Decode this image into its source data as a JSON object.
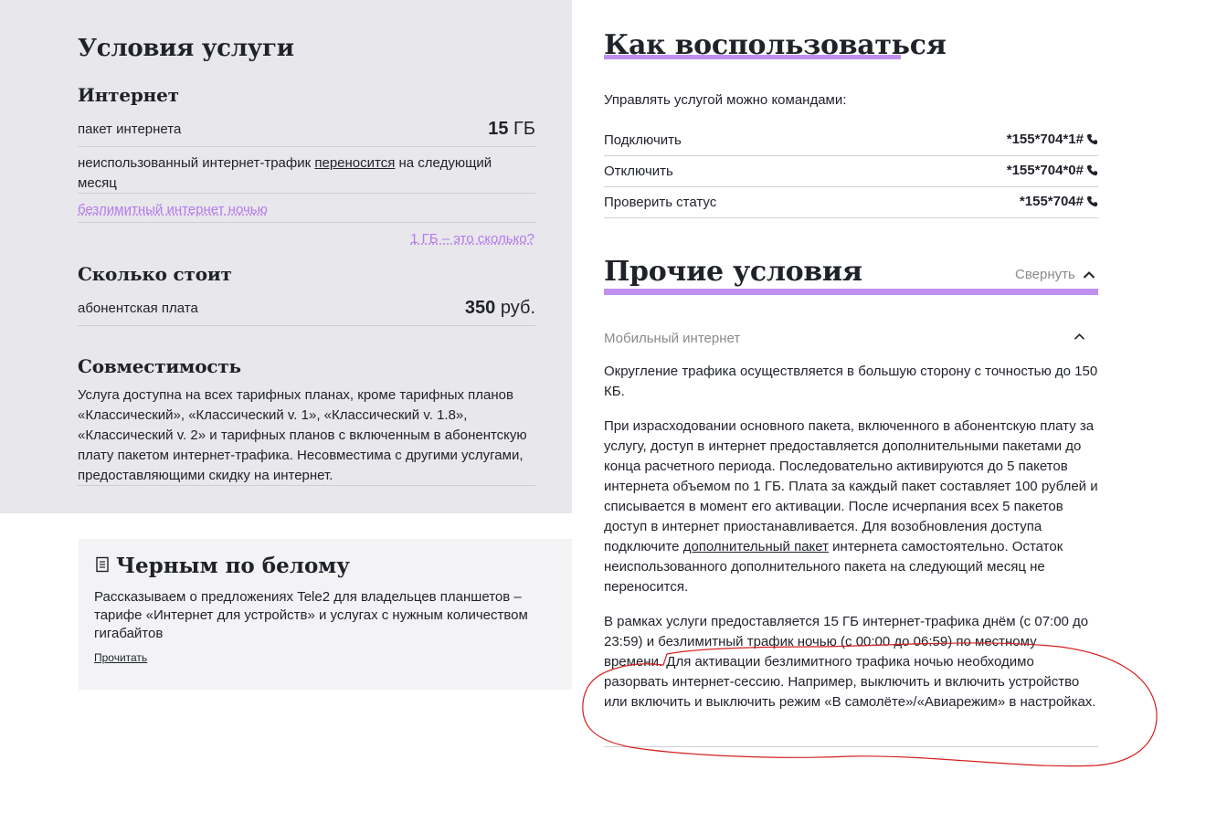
{
  "conditions": {
    "title": "Условия услуги",
    "internet": {
      "heading": "Интернет",
      "package_label": "пакет интернета",
      "package_value": "15",
      "package_unit": "ГБ",
      "rollover_text_before": "неиспользованный интернет-трафик",
      "rollover_link": "переносится",
      "rollover_text_after": "на следующий месяц",
      "night_link": "безлимитный интернет ночью",
      "gb_link": "1 ГБ – это сколько?"
    },
    "price": {
      "heading": "Сколько стоит",
      "fee_label": "абонентская плата",
      "fee_value": "350",
      "fee_unit": "руб."
    },
    "compat": {
      "heading": "Совместимость",
      "text": "Услуга доступна на всех тарифных планах, кроме тарифных планов «Классический», «Классический v. 1», «Классический v. 1.8», «Классический v. 2» и тарифных планов с включенным в абонентскую плату пакетом интернет-трафика. Несовместима с другими услугами, предоставляющими скидку на интернет."
    }
  },
  "card": {
    "title": "Черным по белому",
    "icon": "document-icon",
    "text": "Рассказываем о предложениях Tele2 для владельцев планшетов – тарифе «Интернет для устройств» и услугах с нужным количеством гигабайтов",
    "link": "Прочитать"
  },
  "howto": {
    "title": "Как воспользоваться",
    "intro": "Управлять услугой можно командами:",
    "commands": [
      {
        "label": "Подключить",
        "code": "*155*704*1#"
      },
      {
        "label": "Отключить",
        "code": "*155*704*0#"
      },
      {
        "label": "Проверить статус",
        "code": "*155*704#"
      }
    ],
    "phone_icon": "phone-icon"
  },
  "other": {
    "title": "Прочие условия",
    "collapse_label": "Свернуть",
    "section_label": "Мобильный интернет",
    "para1": "Округление трафика осуществляется в большую сторону с точностью до 150 КБ.",
    "para2_before": "При израсходовании основного пакета, включенного в абонентскую плату за услугу, доступ в интернет предоставляется дополнительными пакетами до конца расчетного периода. Последовательно активируются до 5 пакетов интернета объемом по 1 ГБ. Плата за каждый пакет составляет 100 рублей и списывается в момент его активации. После исчерпания всех 5 пакетов доступ в интернет приостанавливается. Для возобновления доступа подключите",
    "para2_link": "дополнительный пакет",
    "para2_after": "интернета самостоятельно. Остаток неиспользованного дополнительного пакета на следующий месяц не переносится.",
    "para3": "В рамках услуги предоставляется 15 ГБ интернет-трафика днём (с 07:00 до 23:59) и безлимитный трафик ночью (с 00:00 до 06:59) по местному времени. Для активации безлимитного трафика ночью необходимо разорвать интернет-сессию. Например, выключить и включить устройство или включить и выключить режим «В самолёте»/«Авиарежим» в настройках."
  },
  "colors": {
    "accent": "#c08ff0",
    "link_purple": "#b57be9",
    "panel_bg": "#e8e7ec",
    "annotation": "#d42020"
  }
}
